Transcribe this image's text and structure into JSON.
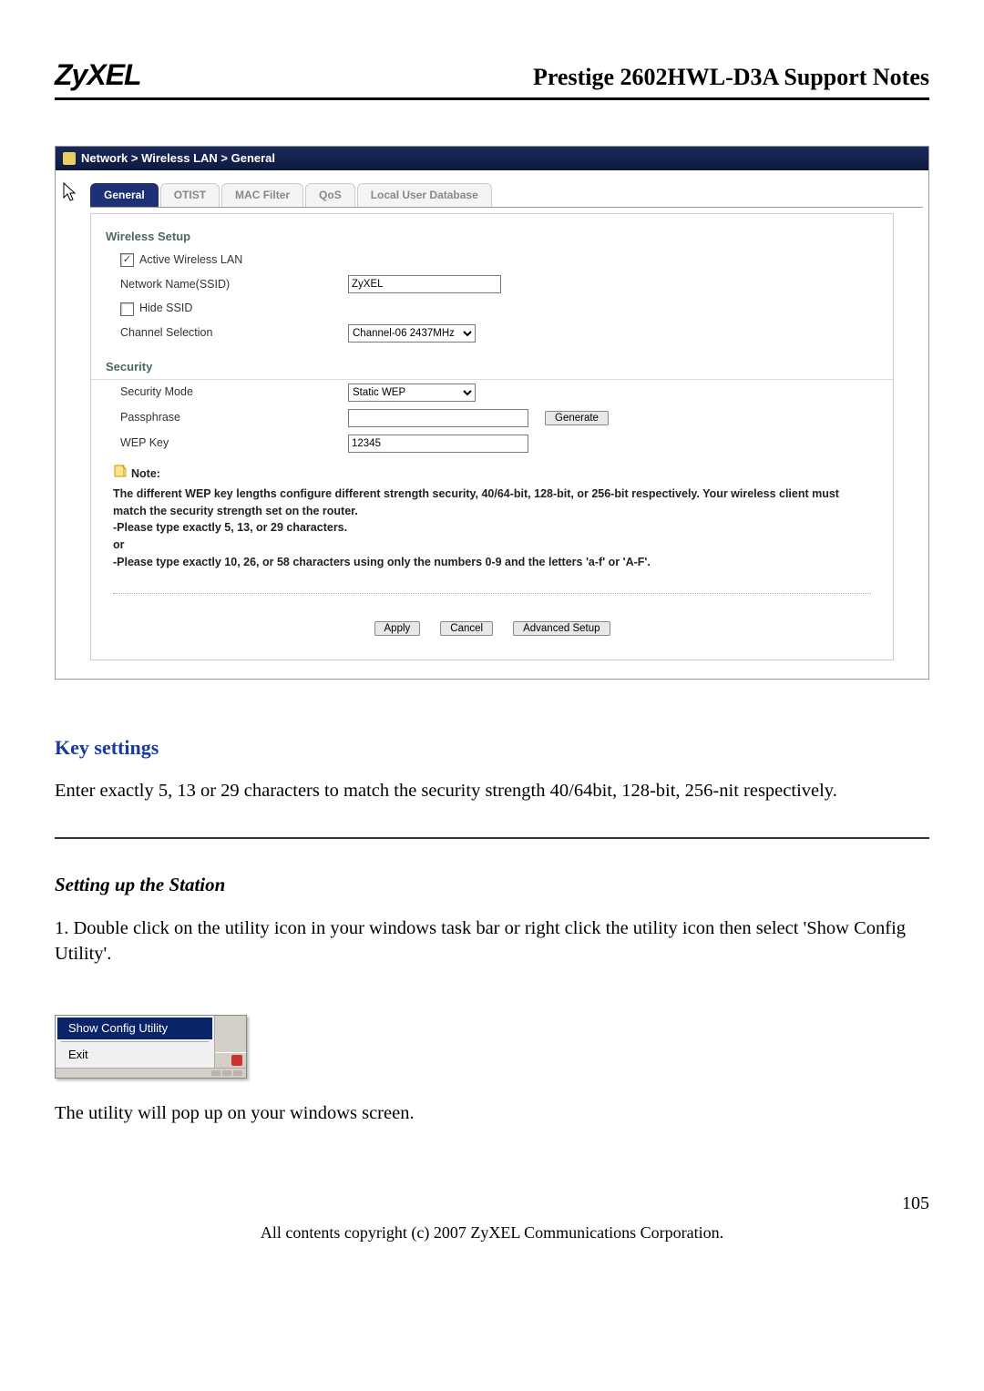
{
  "header": {
    "logo_text": "ZyXEL",
    "doc_title": "Prestige 2602HWL-D3A Support Notes"
  },
  "panel": {
    "breadcrumb": "Network > Wireless LAN > General",
    "tabs": [
      "General",
      "OTIST",
      "MAC Filter",
      "QoS",
      "Local User Database"
    ],
    "wireless": {
      "section_title": "Wireless Setup",
      "active_label": "Active Wireless LAN",
      "active_checked": "✓",
      "ssid_label": "Network Name(SSID)",
      "ssid_value": "ZyXEL",
      "hide_label": "Hide SSID",
      "channel_label": "Channel Selection",
      "channel_value": "Channel-06 2437MHz"
    },
    "security": {
      "section_title": "Security",
      "mode_label": "Security Mode",
      "mode_value": "Static WEP",
      "pass_label": "Passphrase",
      "pass_value": "",
      "generate": "Generate",
      "wep_label": "WEP Key",
      "wep_value": "12345"
    },
    "note": {
      "title": "Note:",
      "l1": "The different WEP key lengths configure different strength security, 40/64-bit, 128-bit, or 256-bit respectively. Your wireless client must match the security strength set on the router.",
      "l2": "-Please type exactly 5, 13, or 29 characters.",
      "l3": "or",
      "l4": "-Please type exactly 10, 26, or 58 characters using only the numbers 0-9 and the letters 'a-f' or 'A-F'."
    },
    "buttons": {
      "apply": "Apply",
      "cancel": "Cancel",
      "advanced": "Advanced Setup"
    }
  },
  "doc": {
    "key_settings_h": "Key settings",
    "key_settings_p": "Enter exactly 5, 13 or 29 characters to match the security strength 40/64bit, 128-bit, 256-nit respectively.",
    "station_h": "Setting up the Station",
    "station_p1": "1. Double click on the utility icon in your windows task bar or right click the utility icon then select 'Show Config Utility'.",
    "menu": {
      "show": "Show Config Utility",
      "exit": "Exit"
    },
    "station_p2": "The utility will pop up on your windows screen."
  },
  "footer": {
    "page_num": "105",
    "copyright": "All contents copyright (c) 2007 ZyXEL Communications Corporation."
  }
}
